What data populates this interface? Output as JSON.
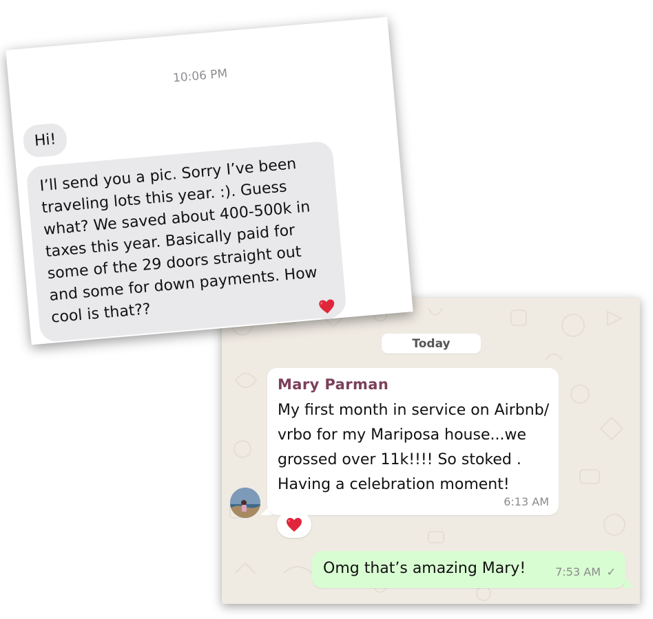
{
  "imessage": {
    "timestamp": "10:06 PM",
    "messages": [
      {
        "text": "Hi!"
      },
      {
        "text": "I’ll send you a pic. Sorry I’ve been traveling lots this year. :). Guess what? We saved about 400-500k in taxes this year. Basically paid for some of the 29 doors straight out and some for down payments. How cool is that??"
      }
    ],
    "reaction_icon": "heart-icon"
  },
  "whatsapp": {
    "date_chip": "Today",
    "incoming": {
      "sender": "Mary  Parman",
      "text": "My first month in service on Airbnb/ vrbo for my Mariposa house...we grossed over 11k!!!! So stoked . Having a celebration moment!",
      "time": "6:13 AM",
      "reaction_icon": "heart-icon"
    },
    "outgoing": {
      "text": "Omg that’s amazing Mary!",
      "time": "7:53 AM",
      "status_icon": "checkmark-icon"
    },
    "colors": {
      "background": "#efeae2",
      "incoming_bubble": "#ffffff",
      "outgoing_bubble": "#d9fdd3",
      "sender_name": "#7b3f5a",
      "heart": "#e0263a"
    }
  }
}
